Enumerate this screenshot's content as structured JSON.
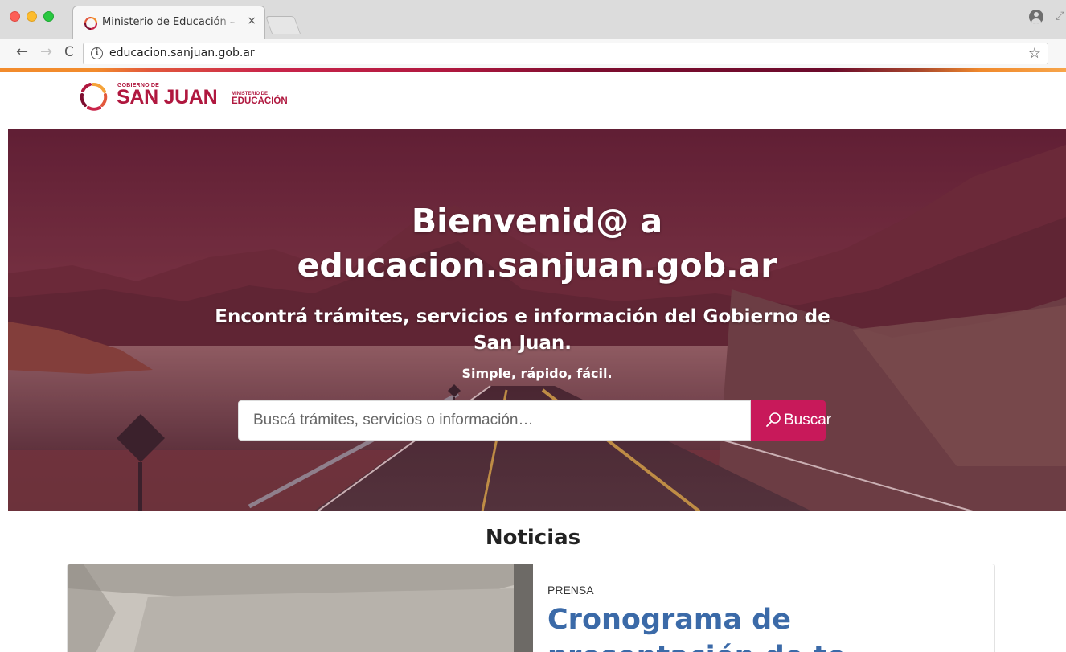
{
  "browser": {
    "tab": {
      "title": "Ministerio de Educación – Gobierno de San Juan",
      "close_glyph": "×"
    },
    "nav": {
      "back_glyph": "←",
      "forward_glyph": "→",
      "reload_glyph": "C"
    },
    "address": {
      "url": "educacion.sanjuan.gob.ar",
      "info_glyph": "i",
      "star_glyph": "☆"
    },
    "icons": [
      "close-icon",
      "back-icon",
      "forward-icon",
      "reload-icon",
      "info-icon",
      "star-icon",
      "profile-icon"
    ]
  },
  "header": {
    "logo": {
      "gov_text": "GOBIERNO DE",
      "name_text": "SAN JUAN",
      "ministry_small": "MINISTERIO DE",
      "ministry_name": "EDUCACIÓN"
    },
    "brand_color": "#b0183f"
  },
  "hero": {
    "title_line1": "Bienvenid@ a",
    "title_line2": "educacion.sanjuan.gob.ar",
    "subtitle": "Encontrá trámites, servicios e información del Gobierno de San Juan.",
    "tagline": "Simple, rápido, fácil.",
    "search": {
      "placeholder": "Buscá trámites, servicios o información…",
      "button_label": "Buscar",
      "button_color": "#c8195a"
    }
  },
  "news": {
    "heading": "Noticias",
    "items": [
      {
        "category": "PRENSA",
        "title": "Cronograma de presentación de to"
      }
    ],
    "title_color": "#3b6aa8"
  }
}
